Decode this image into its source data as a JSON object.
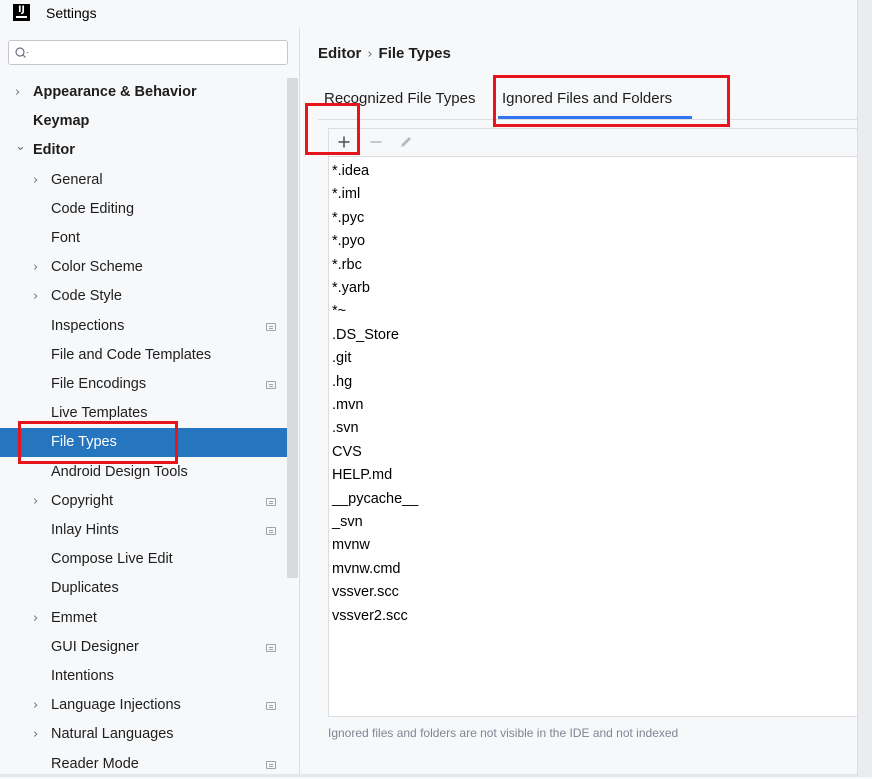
{
  "window": {
    "title": "Settings",
    "logo_text": "IJ"
  },
  "search": {
    "placeholder": ""
  },
  "sidebar": {
    "items": [
      {
        "label": "Appearance & Behavior",
        "expandable": true,
        "expanded": false,
        "bold": true
      },
      {
        "label": "Keymap",
        "expandable": false,
        "bold": true
      },
      {
        "label": "Editor",
        "expandable": true,
        "expanded": true,
        "bold": true
      },
      {
        "label": "General",
        "expandable": true,
        "expanded": false
      },
      {
        "label": "Code Editing"
      },
      {
        "label": "Font"
      },
      {
        "label": "Color Scheme",
        "expandable": true,
        "expanded": false
      },
      {
        "label": "Code Style",
        "expandable": true,
        "expanded": false
      },
      {
        "label": "Inspections",
        "project_icon": true
      },
      {
        "label": "File and Code Templates"
      },
      {
        "label": "File Encodings",
        "project_icon": true
      },
      {
        "label": "Live Templates"
      },
      {
        "label": "File Types",
        "selected": true
      },
      {
        "label": "Android Design Tools"
      },
      {
        "label": "Copyright",
        "expandable": true,
        "expanded": false,
        "project_icon": true
      },
      {
        "label": "Inlay Hints",
        "project_icon": true
      },
      {
        "label": "Compose Live Edit"
      },
      {
        "label": "Duplicates"
      },
      {
        "label": "Emmet",
        "expandable": true,
        "expanded": false
      },
      {
        "label": "GUI Designer",
        "project_icon": true
      },
      {
        "label": "Intentions"
      },
      {
        "label": "Language Injections",
        "expandable": true,
        "expanded": false,
        "project_icon": true
      },
      {
        "label": "Natural Languages",
        "expandable": true,
        "expanded": false
      },
      {
        "label": "Reader Mode",
        "project_icon": true
      }
    ]
  },
  "breadcrumb": {
    "parent": "Editor",
    "separator": "›",
    "current": "File Types"
  },
  "tabs": [
    {
      "label": "Recognized File Types",
      "active": false
    },
    {
      "label": "Ignored Files and Folders",
      "active": true
    }
  ],
  "toolbar": {
    "add_icon": "plus-icon",
    "remove_icon": "minus-icon",
    "edit_icon": "pencil-icon"
  },
  "ignored_list": [
    "*.idea",
    "*.iml",
    "*.pyc",
    "*.pyo",
    "*.rbc",
    "*.yarb",
    "*~",
    ".DS_Store",
    ".git",
    ".hg",
    ".mvn",
    ".svn",
    "CVS",
    "HELP.md",
    "__pycache__",
    "_svn",
    "mvnw",
    "mvnw.cmd",
    "vssver.scc",
    "vssver2.scc"
  ],
  "hint": "Ignored files and folders are not visible in the IDE and not indexed",
  "colors": {
    "selection": "#2675bf",
    "tab_underline": "#3574f0",
    "highlight": "#e8141b"
  }
}
